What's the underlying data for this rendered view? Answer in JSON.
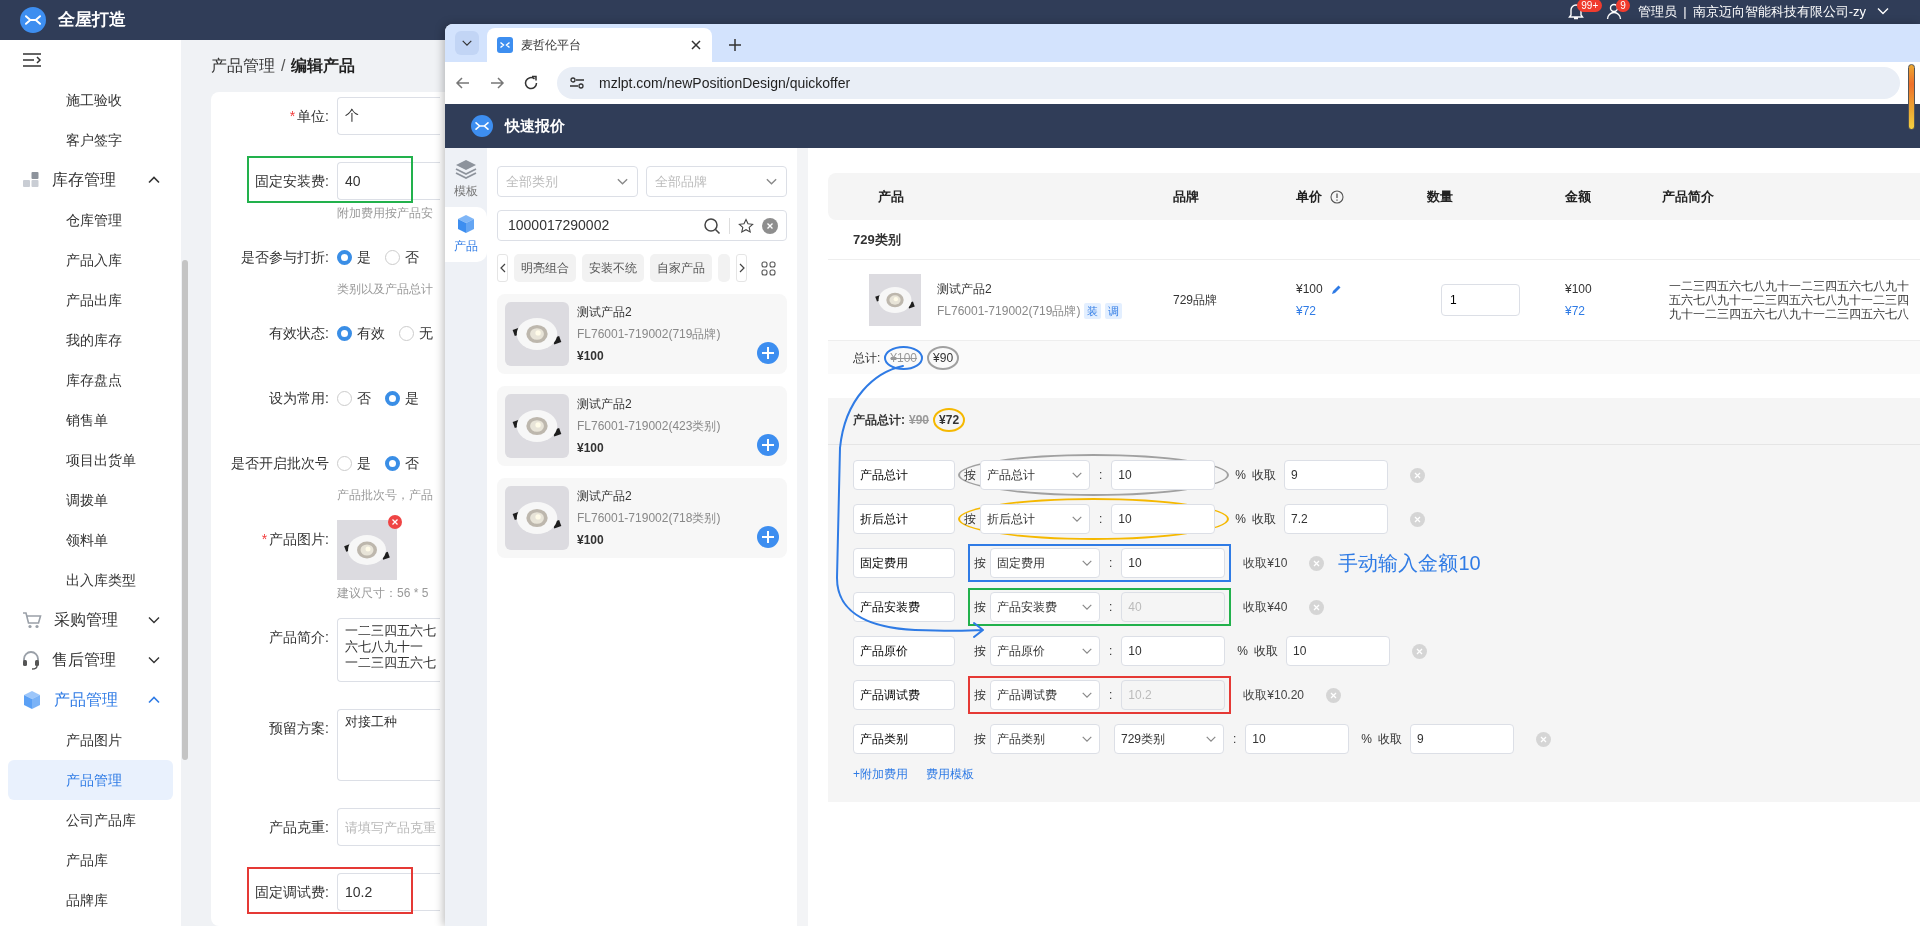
{
  "app": {
    "title": "全屋打造",
    "notifications_badge": "99+",
    "messages_badge": "9",
    "user": "管理员",
    "separator": "|",
    "company": "南京迈向智能科技有限公司-zy"
  },
  "sidebar": {
    "items": [
      {
        "kind": "sub",
        "label": "施工验收",
        "selected": false
      },
      {
        "kind": "sub",
        "label": "客户签字",
        "selected": false
      },
      {
        "kind": "group",
        "label": "库存管理",
        "expanded": true,
        "active": false
      },
      {
        "kind": "sub",
        "label": "仓库管理",
        "selected": false
      },
      {
        "kind": "sub",
        "label": "产品入库",
        "selected": false
      },
      {
        "kind": "sub",
        "label": "产品出库",
        "selected": false
      },
      {
        "kind": "sub",
        "label": "我的库存",
        "selected": false
      },
      {
        "kind": "sub",
        "label": "库存盘点",
        "selected": false
      },
      {
        "kind": "sub",
        "label": "销售单",
        "selected": false
      },
      {
        "kind": "sub",
        "label": "项目出货单",
        "selected": false
      },
      {
        "kind": "sub",
        "label": "调拨单",
        "selected": false
      },
      {
        "kind": "sub",
        "label": "领料单",
        "selected": false
      },
      {
        "kind": "sub",
        "label": "出入库类型",
        "selected": false
      },
      {
        "kind": "group",
        "label": "采购管理",
        "expanded": false,
        "active": false
      },
      {
        "kind": "group",
        "label": "售后管理",
        "expanded": false,
        "active": false
      },
      {
        "kind": "group",
        "label": "产品管理",
        "expanded": true,
        "active": true
      },
      {
        "kind": "sub",
        "label": "产品图片",
        "selected": false
      },
      {
        "kind": "sub",
        "label": "产品管理",
        "selected": true
      },
      {
        "kind": "sub",
        "label": "公司产品库",
        "selected": false
      },
      {
        "kind": "sub",
        "label": "产品库",
        "selected": false
      },
      {
        "kind": "sub",
        "label": "品牌库",
        "selected": false
      }
    ]
  },
  "breadcrumb": {
    "parent": "产品管理",
    "separator": "/",
    "current": "编辑产品"
  },
  "form": {
    "fields": [
      {
        "kind": "text",
        "required_mark": "*",
        "label": "单位:",
        "value": "个"
      },
      {
        "kind": "text",
        "label": "固定安装费:",
        "value": "40",
        "hint": "附加费用按产品安",
        "highlight": {
          "color": "#22b14c"
        }
      },
      {
        "kind": "radio",
        "label": "是否参与打折:",
        "options": [
          {
            "label": "是",
            "selected": true
          },
          {
            "label": "否",
            "selected": false
          }
        ],
        "hint": "类别以及产品总计"
      },
      {
        "kind": "radio",
        "label": "有效状态:",
        "options": [
          {
            "label": "有效",
            "selected": true
          },
          {
            "label": "无",
            "selected": false
          }
        ]
      },
      {
        "kind": "radio",
        "label": "设为常用:",
        "options": [
          {
            "label": "否",
            "selected": false
          },
          {
            "label": "是",
            "selected": true
          }
        ]
      },
      {
        "kind": "radio",
        "label": "是否开启批次号",
        "options": [
          {
            "label": "是",
            "selected": false
          },
          {
            "label": "否",
            "selected": true
          }
        ],
        "hint": "产品批次号，产品"
      },
      {
        "required_mark": "*",
        "label": "产品图片:",
        "hint": "建议尺寸：56 * 5"
      },
      {
        "kind": "textarea",
        "label": "产品简介:",
        "lines": [
          "一二三四五六七",
          "六七八九十一",
          "一二三四五六七"
        ]
      },
      {
        "kind": "textarea",
        "label": "预留方案:",
        "lines": [
          "对接工种"
        ]
      },
      {
        "kind": "text",
        "label": "产品克重:",
        "placeholder": "请填写产品克重"
      },
      {
        "kind": "text",
        "label": "固定调试费:",
        "value": "10.2",
        "highlight": {
          "color": "#e53935"
        }
      }
    ]
  },
  "browser": {
    "tab_title": "麦哲伦平台",
    "url": "mzlpt.com/newPositionDesign/quickoffer"
  },
  "quote": {
    "header": "快速报价",
    "rail": [
      {
        "label": "模板",
        "selected": false
      },
      {
        "label": "产品",
        "selected": true
      }
    ],
    "filters": {
      "category_placeholder": "全部类别",
      "brand_placeholder": "全部品牌",
      "search_value": "1000017290002"
    },
    "chips": [
      "明亮组合",
      "安装不统",
      "自家产品"
    ],
    "products": [
      {
        "name": "测试产品2",
        "code": "FL76001-719002(719品牌)",
        "price": "¥100"
      },
      {
        "name": "测试产品2",
        "code": "FL76001-719002(423类别)",
        "price": "¥100"
      },
      {
        "name": "测试产品2",
        "code": "FL76001-719002(718类别)",
        "price": "¥100"
      }
    ]
  },
  "table": {
    "columns": [
      "产品",
      "品牌",
      "单价",
      "数量",
      "金额",
      "产品简介"
    ],
    "groups": [
      {
        "title": "729类别",
        "rows": [
          {
            "name": "测试产品2",
            "code": "FL76001-719002(719品牌)",
            "tags": [
              "装",
              "调"
            ],
            "brand": "729品牌",
            "price": "¥100",
            "discounted_price": "¥72",
            "quantity": "1",
            "amount": "¥100",
            "discounted_amount": "¥72",
            "intro_lines": [
              "一二三四五六七八九十一二三四五六七八九十",
              "五六七八九十一二三四五六七八九十一二三四",
              "九十一二三四五六七八九十一二三四五六七八"
            ]
          }
        ],
        "total_label": "总计:",
        "total_original": "¥100",
        "total_original_circle": {
          "color": "#2f7be5"
        },
        "total": "¥90",
        "total_circle": {
          "color": "#a0a0a0"
        }
      }
    ]
  },
  "fees": {
    "summary": {
      "label": "产品总计:",
      "original": "¥90",
      "total": "¥72",
      "total_circle": {
        "color": "#f5b800"
      }
    },
    "rows": [
      {
        "kind": "percent",
        "name": "产品总计",
        "by": "按",
        "basis": "产品总计",
        "colon": ":",
        "value": "10",
        "disabled": false,
        "percent": "%",
        "collect": "收取",
        "result": "9",
        "highlight": {
          "kind": "ellipse",
          "color": "#a0a0a0"
        }
      },
      {
        "kind": "percent",
        "name": "折后总计",
        "by": "按",
        "basis": "折后总计",
        "colon": ":",
        "value": "10",
        "disabled": false,
        "percent": "%",
        "collect": "收取",
        "result": "7.2",
        "highlight": {
          "kind": "ellipse",
          "color": "#f5b800"
        }
      },
      {
        "kind": "fixed",
        "name": "固定费用",
        "by": "按",
        "basis": "固定费用",
        "colon": ":",
        "value": "10",
        "disabled": false,
        "collect": "收取¥10",
        "highlight": {
          "kind": "rect",
          "color": "#2f7be5"
        },
        "note": "手动输入金额10"
      },
      {
        "kind": "fixed",
        "name": "产品安装费",
        "by": "按",
        "basis": "产品安装费",
        "colon": ":",
        "value": "40",
        "disabled": true,
        "collect": "收取¥40",
        "highlight": {
          "kind": "rect",
          "color": "#22b14c"
        }
      },
      {
        "kind": "percent",
        "name": "产品原价",
        "by": "按",
        "basis": "产品原价",
        "colon": ":",
        "value": "10",
        "disabled": false,
        "percent": "%",
        "collect": "收取",
        "result": "10"
      },
      {
        "kind": "fixed",
        "name": "产品调试费",
        "by": "按",
        "basis": "产品调试费",
        "colon": ":",
        "value": "10.2",
        "disabled": true,
        "collect": "收取¥10.20",
        "highlight": {
          "kind": "rect",
          "color": "#e53935"
        }
      },
      {
        "kind": "category",
        "name": "产品类别",
        "by": "按",
        "basis": "产品类别",
        "category": "729类别",
        "colon": ":",
        "value": "10",
        "disabled": false,
        "percent": "%",
        "collect": "收取",
        "result": "9"
      }
    ],
    "links": [
      "+附加费用",
      "费用模板"
    ]
  }
}
